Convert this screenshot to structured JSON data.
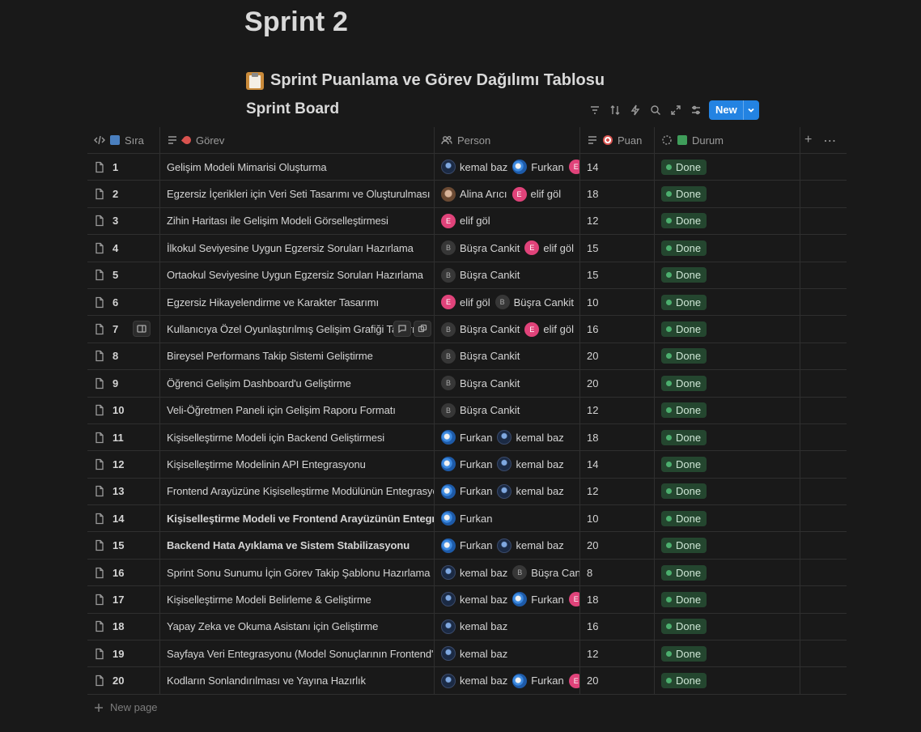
{
  "page": {
    "title": "Sprint 2"
  },
  "section": {
    "heading": "Sprint Puanlama ve Görev Dağılımı Tablosu",
    "emoji_icon": "clipboard-icon"
  },
  "board": {
    "title": "Sprint Board",
    "new_label": "New"
  },
  "columns": {
    "sira": "Sıra",
    "gorev": "Görev",
    "person": "Person",
    "puan": "Puan",
    "durum": "Durum"
  },
  "status_color": "#24462f",
  "accent": "#2383e2",
  "rows": [
    {
      "num": "1",
      "title": "Gelişim Modeli Mimarisi Oluşturma",
      "bold": false,
      "people": [
        {
          "name": "kemal baz",
          "av": "kemal"
        },
        {
          "name": "Furkan",
          "av": "furkan"
        },
        {
          "name": "",
          "av": "elif",
          "initial": "E"
        }
      ],
      "puan": "14",
      "status": "Done"
    },
    {
      "num": "2",
      "title": "Egzersiz İçerikleri için Veri Seti Tasarımı ve Oluşturulması",
      "bold": false,
      "people": [
        {
          "name": "Alina Arıcı",
          "av": "alina"
        },
        {
          "name": "elif göl",
          "av": "elif",
          "initial": "E"
        }
      ],
      "puan": "18",
      "status": "Done"
    },
    {
      "num": "3",
      "title": "Zihin Haritası ile Gelişim Modeli Görselleştirmesi",
      "bold": false,
      "people": [
        {
          "name": "elif göl",
          "av": "elif",
          "initial": "E"
        }
      ],
      "puan": "12",
      "status": "Done"
    },
    {
      "num": "4",
      "title": "İlkokul Seviyesine Uygun Egzersiz Soruları Hazırlama",
      "bold": false,
      "people": [
        {
          "name": "Büşra Cankit",
          "av": "busra",
          "initial": "B"
        },
        {
          "name": "elif göl",
          "av": "elif",
          "initial": "E"
        }
      ],
      "puan": "15",
      "status": "Done"
    },
    {
      "num": "5",
      "title": "Ortaokul Seviyesine Uygun Egzersiz Soruları Hazırlama",
      "bold": false,
      "people": [
        {
          "name": "Büşra Cankit",
          "av": "busra",
          "initial": "B"
        }
      ],
      "puan": "15",
      "status": "Done"
    },
    {
      "num": "6",
      "title": "Egzersiz Hikayelendirme ve Karakter Tasarımı",
      "bold": false,
      "people": [
        {
          "name": "elif göl",
          "av": "elif",
          "initial": "E"
        },
        {
          "name": "Büşra Cankit",
          "av": "busra",
          "initial": "B"
        }
      ],
      "puan": "10",
      "status": "Done"
    },
    {
      "num": "7",
      "title": "Kullanıcıya Özel Oyunlaştırılmış Gelişim Grafiği Tasarımı",
      "bold": false,
      "people": [
        {
          "name": "Büşra Cankit",
          "av": "busra",
          "initial": "B"
        },
        {
          "name": "elif göl",
          "av": "elif",
          "initial": "E"
        }
      ],
      "puan": "16",
      "status": "Done"
    },
    {
      "num": "8",
      "title": "Bireysel Performans Takip Sistemi Geliştirme",
      "bold": false,
      "people": [
        {
          "name": "Büşra Cankit",
          "av": "busra",
          "initial": "B"
        }
      ],
      "puan": "20",
      "status": "Done"
    },
    {
      "num": "9",
      "title": "Öğrenci Gelişim Dashboard'u Geliştirme",
      "bold": false,
      "people": [
        {
          "name": "Büşra Cankit",
          "av": "busra",
          "initial": "B"
        }
      ],
      "puan": "20",
      "status": "Done"
    },
    {
      "num": "10",
      "title": "Veli-Öğretmen Paneli için Gelişim Raporu Formatı",
      "bold": false,
      "people": [
        {
          "name": "Büşra Cankit",
          "av": "busra",
          "initial": "B"
        }
      ],
      "puan": "12",
      "status": "Done"
    },
    {
      "num": "11",
      "title": "Kişiselleştirme Modeli için Backend Geliştirmesi",
      "bold": false,
      "people": [
        {
          "name": "Furkan",
          "av": "furkan"
        },
        {
          "name": "kemal baz",
          "av": "kemal"
        }
      ],
      "puan": "18",
      "status": "Done"
    },
    {
      "num": "12",
      "title": "Kişiselleştirme Modelinin API Entegrasyonu",
      "bold": false,
      "people": [
        {
          "name": "Furkan",
          "av": "furkan"
        },
        {
          "name": "kemal baz",
          "av": "kemal"
        }
      ],
      "puan": "14",
      "status": "Done"
    },
    {
      "num": "13",
      "title": "Frontend Arayüzüne Kişiselleştirme Modülünün Entegrasyonu",
      "bold": false,
      "people": [
        {
          "name": "Furkan",
          "av": "furkan"
        },
        {
          "name": "kemal baz",
          "av": "kemal"
        }
      ],
      "puan": "12",
      "status": "Done"
    },
    {
      "num": "14",
      "title": "Kişiselleştirme Modeli ve Frontend Arayüzünün Entegrasyonu",
      "bold": true,
      "people": [
        {
          "name": "Furkan",
          "av": "furkan"
        }
      ],
      "puan": "10",
      "status": "Done"
    },
    {
      "num": "15",
      "title": "Backend Hata Ayıklama ve Sistem Stabilizasyonu",
      "bold": true,
      "people": [
        {
          "name": "Furkan",
          "av": "furkan"
        },
        {
          "name": "kemal baz",
          "av": "kemal"
        }
      ],
      "puan": "20",
      "status": "Done"
    },
    {
      "num": "16",
      "title": "Sprint Sonu Sunumu İçin Görev Takip Şablonu Hazırlama",
      "bold": false,
      "people": [
        {
          "name": "kemal baz",
          "av": "kemal"
        },
        {
          "name": "Büşra Cankit",
          "av": "busra",
          "initial": "B"
        }
      ],
      "puan": "8",
      "status": "Done"
    },
    {
      "num": "17",
      "title": "Kişiselleştirme Modeli Belirleme & Geliştirme",
      "bold": false,
      "people": [
        {
          "name": "kemal baz",
          "av": "kemal"
        },
        {
          "name": "Furkan",
          "av": "furkan"
        },
        {
          "name": "",
          "av": "elif",
          "initial": "E"
        }
      ],
      "puan": "18",
      "status": "Done"
    },
    {
      "num": "18",
      "title": "Yapay Zeka ve Okuma Asistanı için Geliştirme",
      "bold": false,
      "people": [
        {
          "name": "kemal baz",
          "av": "kemal"
        }
      ],
      "puan": "16",
      "status": "Done"
    },
    {
      "num": "19",
      "title": "Sayfaya Veri Entegrasyonu (Model Sonuçlarının Frontend'e Bağlanması)",
      "bold": false,
      "people": [
        {
          "name": "kemal baz",
          "av": "kemal"
        }
      ],
      "puan": "12",
      "status": "Done"
    },
    {
      "num": "20",
      "title": "Kodların Sonlandırılması ve Yayına Hazırlık",
      "bold": false,
      "people": [
        {
          "name": "kemal baz",
          "av": "kemal"
        },
        {
          "name": "Furkan",
          "av": "furkan"
        },
        {
          "name": "",
          "av": "elif",
          "initial": "E"
        }
      ],
      "puan": "20",
      "status": "Done"
    }
  ],
  "footer": {
    "new_page": "New page"
  }
}
